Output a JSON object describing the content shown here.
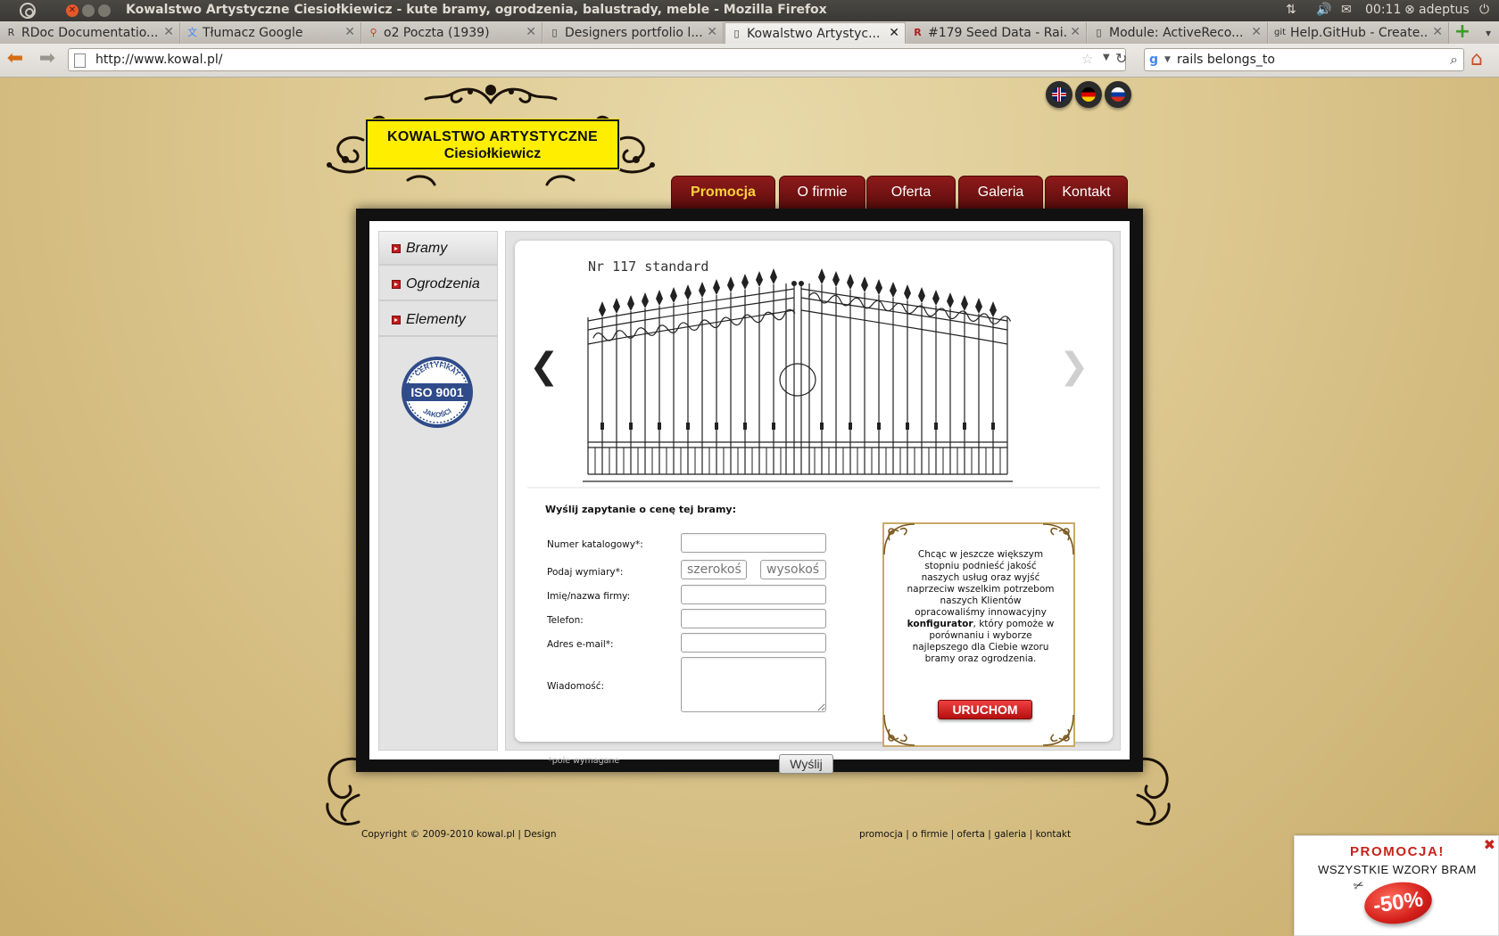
{
  "os": {
    "window_title": "Kowalstwo Artystyczne Ciesiołkiewicz - kute bramy, ogrodzenia, balustrady, meble - Mozilla Firefox",
    "clock": "00:11",
    "user": "adeptus"
  },
  "tabs": [
    {
      "label": "RDoc Documentatio...",
      "icon": "rdoc-icon"
    },
    {
      "label": "Tłumacz Google",
      "icon": "translate-icon"
    },
    {
      "label": "o2 Poczta (1939)",
      "icon": "o2-icon"
    },
    {
      "label": "Designers portfolio l...",
      "icon": "page-icon"
    },
    {
      "label": "Kowalstwo Artystyc...",
      "icon": "page-icon",
      "active": true
    },
    {
      "label": "#179 Seed Data - Rai...",
      "icon": "railscasts-icon"
    },
    {
      "label": "Module: ActiveReco...",
      "icon": "page-icon"
    },
    {
      "label": "Help.GitHub - Create...",
      "icon": "git-icon"
    }
  ],
  "nav": {
    "url": "http://www.kowal.pl/",
    "search_query": "rails belongs_to"
  },
  "site": {
    "logo_line1": "KOWALSTWO ARTYSTYCZNE",
    "logo_line2": "Ciesiołkiewicz",
    "languages": [
      "en",
      "de",
      "ru"
    ],
    "menu": [
      {
        "label": "Promocja",
        "active": true
      },
      {
        "label": "O firmie"
      },
      {
        "label": "Oferta"
      },
      {
        "label": "Galeria"
      },
      {
        "label": "Kontakt"
      }
    ],
    "sidebar": [
      {
        "label": "Bramy",
        "active": true
      },
      {
        "label": "Ogrodzenia"
      },
      {
        "label": "Elementy"
      }
    ],
    "iso_badge": {
      "top": "CERTYFIKAT",
      "middle": "ISO 9001",
      "bottom": "JAKOŚCI"
    },
    "gate_caption": "Nr 117 standard",
    "form": {
      "title": "Wyślij zapytanie o cenę tej bramy:",
      "catalog_label": "Numer katalogowy*:",
      "dims_label": "Podaj wymiary*:",
      "width_placeholder": "szerokość",
      "height_placeholder": "wysokość",
      "name_label": "Imię/nazwa firmy:",
      "phone_label": "Telefon:",
      "email_label": "Adres e-mail*:",
      "message_label": "Wiadomość:",
      "required_note": "*pole wymagane",
      "submit_label": "Wyślij"
    },
    "promo_box": {
      "text_before": "Chcąc w jeszcze większym stopniu podnieść jakość naszych usług oraz wyjść naprzeciw wszelkim potrzebom naszych Klientów opracowaliśmy innowacyjny",
      "text_bold": "konfigurator",
      "text_after": ", który pomoże w porównaniu i wyborze najlepszego dla Ciebie wzoru bramy oraz ogrodzenia.",
      "button_label": "URUCHOM"
    },
    "footer": {
      "copyright": "Copyright © 2009-2010 kowal.pl | Design",
      "links": [
        "promocja",
        "o firmie",
        "oferta",
        "galeria",
        "kontakt"
      ]
    },
    "popup": {
      "title": "PROMOCJA!",
      "subtitle": "WSZYSTKIE WZORY BRAM",
      "badge": "-50%"
    }
  }
}
